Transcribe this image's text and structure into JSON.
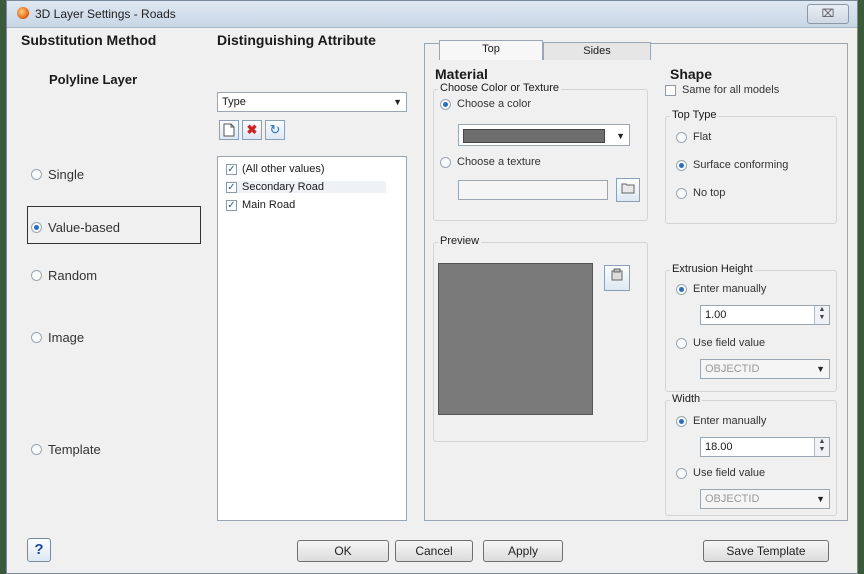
{
  "window": {
    "title": "3D Layer Settings - Roads",
    "close_label": "⌧"
  },
  "left": {
    "heading": "Substitution Method",
    "layer_type": "Polyline Layer",
    "options": [
      {
        "label": "Single",
        "selected": false
      },
      {
        "label": "Value-based",
        "selected": true
      },
      {
        "label": "Random",
        "selected": false
      },
      {
        "label": "Image",
        "selected": false
      },
      {
        "label": "Template",
        "selected": false
      }
    ]
  },
  "middle": {
    "heading": "Distinguishing Attribute",
    "attribute_value": "Type",
    "toolbar": {
      "new_icon": "new-document-icon",
      "delete_icon": "delete-x-icon",
      "refresh_icon": "refresh-icon"
    },
    "items": [
      {
        "label": "(All other values)",
        "checked": true
      },
      {
        "label": "Secondary Road",
        "checked": true
      },
      {
        "label": "Main Road",
        "checked": true
      }
    ]
  },
  "tabs": [
    {
      "label": "Top",
      "active": true
    },
    {
      "label": "Sides",
      "active": false
    }
  ],
  "material": {
    "heading": "Material",
    "group_title": "Choose Color or Texture",
    "choose_color": "Choose a color",
    "choose_texture": "Choose a texture",
    "color_value": "#6e6e6e",
    "preview_title": "Preview",
    "preview_color": "#7a7a7a"
  },
  "shape": {
    "heading": "Shape",
    "same_for_all": "Same for all models",
    "top_type_title": "Top Type",
    "top_types": [
      {
        "label": "Flat",
        "selected": false
      },
      {
        "label": "Surface conforming",
        "selected": true
      },
      {
        "label": "No top",
        "selected": false
      }
    ],
    "extrusion": {
      "title": "Extrusion Height",
      "enter_manually": "Enter manually",
      "value": "1.00",
      "use_field": "Use field value",
      "field": "OBJECTID"
    },
    "width": {
      "title": "Width",
      "enter_manually": "Enter manually",
      "value": "18.00",
      "use_field": "Use field value",
      "field": "OBJECTID"
    }
  },
  "footer": {
    "help": "?",
    "ok": "OK",
    "cancel": "Cancel",
    "apply": "Apply",
    "save_template": "Save Template"
  }
}
